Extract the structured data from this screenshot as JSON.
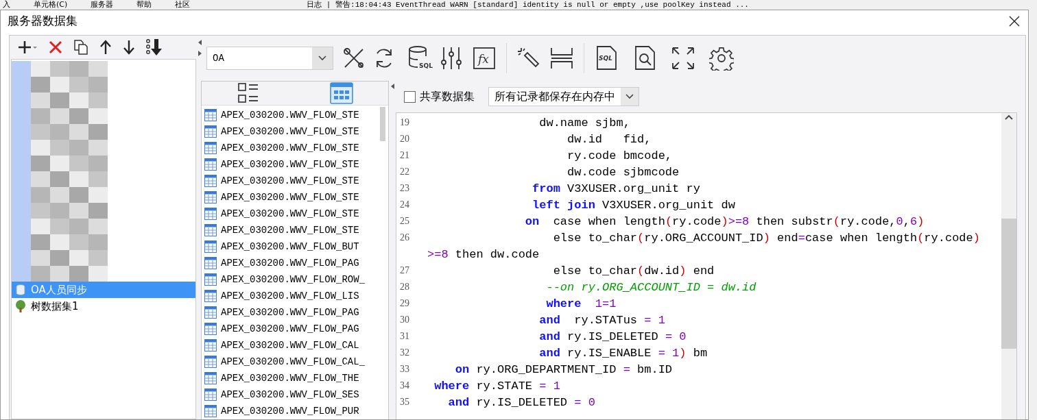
{
  "background_menu": {
    "items": [
      "入",
      "单元格(C)",
      "服务器",
      "帮助",
      "社区"
    ],
    "log": "日志 | 警告:18:04:43 EventThread WARN [standard] identity is null or empty ,use poolKey instead ..."
  },
  "window": {
    "title": "服务器数据集"
  },
  "tree": {
    "items": [
      {
        "label": "OA人员同步",
        "kind": "dataset",
        "selected": true
      },
      {
        "label": "树数据集1",
        "kind": "tree",
        "selected": false
      }
    ]
  },
  "toolbar": {
    "connection": "OA",
    "db_icon_text": "SQL",
    "fx_icon_text": "fx",
    "sql_doc_icon_text": "SQL"
  },
  "table_list": {
    "views": [
      {
        "kind": "list",
        "selected": false
      },
      {
        "kind": "grid",
        "selected": true
      }
    ],
    "rows": [
      "APEX_030200.WWV_FLOW_STE",
      "APEX_030200.WWV_FLOW_STE",
      "APEX_030200.WWV_FLOW_STE",
      "APEX_030200.WWV_FLOW_STE",
      "APEX_030200.WWV_FLOW_STE",
      "APEX_030200.WWV_FLOW_STE",
      "APEX_030200.WWV_FLOW_STE",
      "APEX_030200.WWV_FLOW_STE",
      "APEX_030200.WWV_FLOW_BUT",
      "APEX_030200.WWV_FLOW_PAG",
      "APEX_030200.WWV_FLOW_ROW_",
      "APEX_030200.WWV_FLOW_LIS",
      "APEX_030200.WWV_FLOW_PAG",
      "APEX_030200.WWV_FLOW_PAG",
      "APEX_030200.WWV_FLOW_CAL",
      "APEX_030200.WWV_FLOW_CAL_",
      "APEX_030200.WWV_FLOW_THE",
      "APEX_030200.WWV_FLOW_SES",
      "APEX_030200.WWV_FLOW_PUR"
    ]
  },
  "options": {
    "share_label": "共享数据集",
    "share_checked": false,
    "storage_mode": "所有记录都保存在内存中"
  },
  "editor": {
    "lines": [
      {
        "number": "19",
        "tokens": [
          {
            "kind": "text",
            "text": "                dw.name sjbm,"
          }
        ]
      },
      {
        "number": "20",
        "tokens": [
          {
            "kind": "text",
            "text": "                    dw.id   fid,"
          }
        ]
      },
      {
        "number": "21",
        "tokens": [
          {
            "kind": "text",
            "text": "                    ry.code bmcode,"
          }
        ]
      },
      {
        "number": "22",
        "tokens": [
          {
            "kind": "text",
            "text": "                    dw.code sjbmcode"
          }
        ]
      },
      {
        "number": "23",
        "tokens": [
          {
            "kind": "keyword",
            "text": "               from"
          },
          {
            "kind": "text",
            "text": " V3XUSER.org_unit ry"
          }
        ]
      },
      {
        "number": "24",
        "tokens": [
          {
            "kind": "keyword",
            "text": "               left"
          },
          {
            "kind": "keyword",
            "text": " join"
          },
          {
            "kind": "text",
            "text": " V3XUSER.org_unit dw"
          }
        ]
      },
      {
        "number": "25",
        "tokens": [
          {
            "kind": "keyword",
            "text": "              on"
          },
          {
            "kind": "text",
            "text": "  case when length"
          },
          {
            "kind": "paren",
            "text": "("
          },
          {
            "kind": "text",
            "text": "ry.code"
          },
          {
            "kind": "paren",
            "text": ")"
          },
          {
            "kind": "number",
            "text": ">=8"
          },
          {
            "kind": "text",
            "text": " then substr"
          },
          {
            "kind": "paren",
            "text": "("
          },
          {
            "kind": "text",
            "text": "ry.code,"
          },
          {
            "kind": "number",
            "text": "0"
          },
          {
            "kind": "text",
            "text": ","
          },
          {
            "kind": "number",
            "text": "6"
          },
          {
            "kind": "paren",
            "text": ")"
          }
        ]
      },
      {
        "number": "26",
        "tokens": [
          {
            "kind": "text",
            "text": "                  else to_char"
          },
          {
            "kind": "paren",
            "text": "("
          },
          {
            "kind": "text",
            "text": "ry.ORG_ACCOUNT_ID"
          },
          {
            "kind": "paren",
            "text": ")"
          },
          {
            "kind": "text",
            "text": " end"
          },
          {
            "kind": "number",
            "text": "="
          },
          {
            "kind": "text",
            "text": "case when length"
          },
          {
            "kind": "paren",
            "text": "("
          },
          {
            "kind": "text",
            "text": "ry.code"
          },
          {
            "kind": "paren",
            "text": ")"
          }
        ]
      },
      {
        "tokens": [
          {
            "kind": "number",
            "text": ">=8"
          },
          {
            "kind": "text",
            "text": " then dw.code"
          }
        ]
      },
      {
        "number": "27",
        "tokens": [
          {
            "kind": "text",
            "text": "                  else to_char"
          },
          {
            "kind": "paren",
            "text": "("
          },
          {
            "kind": "text",
            "text": "dw.id"
          },
          {
            "kind": "paren",
            "text": ")"
          },
          {
            "kind": "text",
            "text": " end"
          }
        ]
      },
      {
        "number": "28",
        "tokens": [
          {
            "kind": "comment",
            "text": "                 --on ry.ORG_ACCOUNT_ID = dw.id"
          }
        ]
      },
      {
        "number": "29",
        "tokens": [
          {
            "kind": "keyword",
            "text": "                 where"
          },
          {
            "kind": "number",
            "text": "  1=1"
          }
        ]
      },
      {
        "number": "30",
        "tokens": [
          {
            "kind": "keyword",
            "text": "                and"
          },
          {
            "kind": "text",
            "text": "  ry.STATus "
          },
          {
            "kind": "number",
            "text": "= 1"
          }
        ]
      },
      {
        "number": "31",
        "tokens": [
          {
            "kind": "keyword",
            "text": "                and"
          },
          {
            "kind": "text",
            "text": " ry.IS_DELETED "
          },
          {
            "kind": "number",
            "text": "= 0"
          }
        ]
      },
      {
        "number": "32",
        "tokens": [
          {
            "kind": "keyword",
            "text": "                and"
          },
          {
            "kind": "text",
            "text": " ry.IS_ENABLE "
          },
          {
            "kind": "number",
            "text": "= 1"
          },
          {
            "kind": "paren",
            "text": ")"
          },
          {
            "kind": "text",
            "text": " bm"
          }
        ]
      },
      {
        "number": "33",
        "tokens": [
          {
            "kind": "keyword",
            "text": "    on"
          },
          {
            "kind": "text",
            "text": " ry.ORG_DEPARTMENT_ID "
          },
          {
            "kind": "number",
            "text": "="
          },
          {
            "kind": "text",
            "text": " bm.ID"
          }
        ]
      },
      {
        "number": "34",
        "tokens": [
          {
            "kind": "keyword",
            "text": " where"
          },
          {
            "kind": "text",
            "text": " ry.STATE "
          },
          {
            "kind": "number",
            "text": "= 1"
          }
        ]
      },
      {
        "number": "35",
        "tokens": [
          {
            "kind": "keyword",
            "text": "   and"
          },
          {
            "kind": "text",
            "text": " ry.IS_DELETED "
          },
          {
            "kind": "number",
            "text": "= 0"
          }
        ]
      }
    ]
  }
}
